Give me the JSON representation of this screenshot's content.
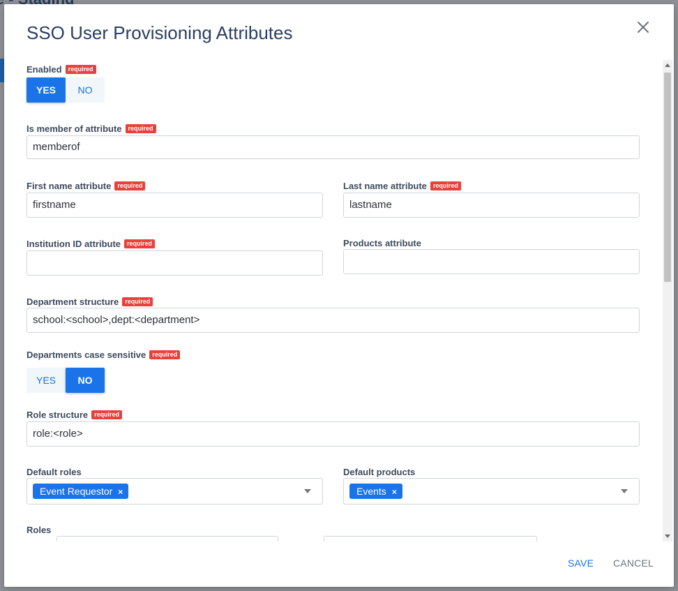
{
  "background": {
    "title_fragment": "e - Staging"
  },
  "modal": {
    "title": "SSO User Provisioning Attributes",
    "close_icon": "close-icon"
  },
  "required_badge": "required",
  "fields": {
    "enabled": {
      "label": "Enabled",
      "yes": "YES",
      "no": "NO",
      "selected": "YES"
    },
    "member_of": {
      "label": "Is member of attribute",
      "value": "memberof"
    },
    "first_name": {
      "label": "First name attribute",
      "value": "firstname"
    },
    "last_name": {
      "label": "Last name attribute",
      "value": "lastname"
    },
    "institution_id": {
      "label": "Institution ID attribute",
      "value": ""
    },
    "products": {
      "label": "Products attribute",
      "value": ""
    },
    "department_structure": {
      "label": "Department structure",
      "value": "school:<school>,dept:<department>"
    },
    "dept_case_sensitive": {
      "label": "Departments case sensitive",
      "yes": "YES",
      "no": "NO",
      "selected": "NO"
    },
    "role_structure": {
      "label": "Role structure",
      "value": "role:<role>"
    },
    "default_roles": {
      "label": "Default roles",
      "chips": [
        "Event Requestor"
      ]
    },
    "default_products": {
      "label": "Default products",
      "chips": [
        "Events"
      ]
    },
    "roles": {
      "label": "Roles"
    }
  },
  "footer": {
    "save": "SAVE",
    "cancel": "CANCEL"
  },
  "colors": {
    "accent": "#1a73e8",
    "required": "#e8413b",
    "title": "#2a3e62"
  }
}
